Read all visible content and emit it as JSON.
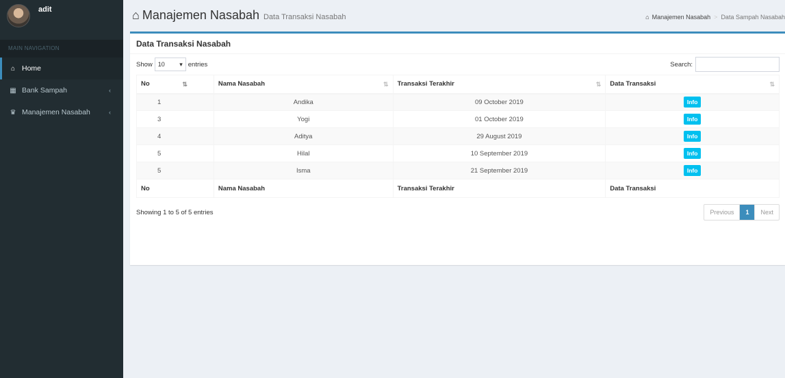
{
  "user": {
    "name": "adit"
  },
  "sidebar": {
    "header": "MAIN NAVIGATION",
    "items": [
      {
        "label": "Home",
        "icon": "home-icon"
      },
      {
        "label": "Bank Sampah",
        "icon": "bank-icon"
      },
      {
        "label": "Manajemen Nasabah",
        "icon": "users-icon"
      }
    ]
  },
  "header": {
    "title": "Manajemen Nasabah",
    "subtitle": "Data Transaksi Nasabah",
    "breadcrumb": [
      "Manajemen Nasabah",
      "Data Sampah Nasabah"
    ]
  },
  "box": {
    "title": "Data Transaksi Nasabah"
  },
  "controls": {
    "show_label": "Show",
    "page_length": "10",
    "entries_label": "entries",
    "search_label": "Search:",
    "search_value": ""
  },
  "table": {
    "columns": [
      "No",
      "Nama Nasabah",
      "Transaksi Terakhir",
      "Data Transaksi"
    ],
    "rows": [
      {
        "no": "1",
        "name": "Andika",
        "date": "09 October 2019",
        "action": "Info"
      },
      {
        "no": "3",
        "name": "Yogi",
        "date": "01 October 2019",
        "action": "Info"
      },
      {
        "no": "4",
        "name": "Aditya",
        "date": "29 August 2019",
        "action": "Info"
      },
      {
        "no": "5",
        "name": "Hilal",
        "date": "10 September 2019",
        "action": "Info"
      },
      {
        "no": "5",
        "name": "Isma",
        "date": "21 September 2019",
        "action": "Info"
      }
    ]
  },
  "footer": {
    "info": "Showing 1 to 5 of 5 entries",
    "previous": "Previous",
    "page": "1",
    "next": "Next"
  },
  "colors": {
    "sidebar_bg": "#222d32",
    "primary": "#3c8dbc",
    "info_button": "#00c0ef",
    "content_bg": "#ecf0f5"
  }
}
